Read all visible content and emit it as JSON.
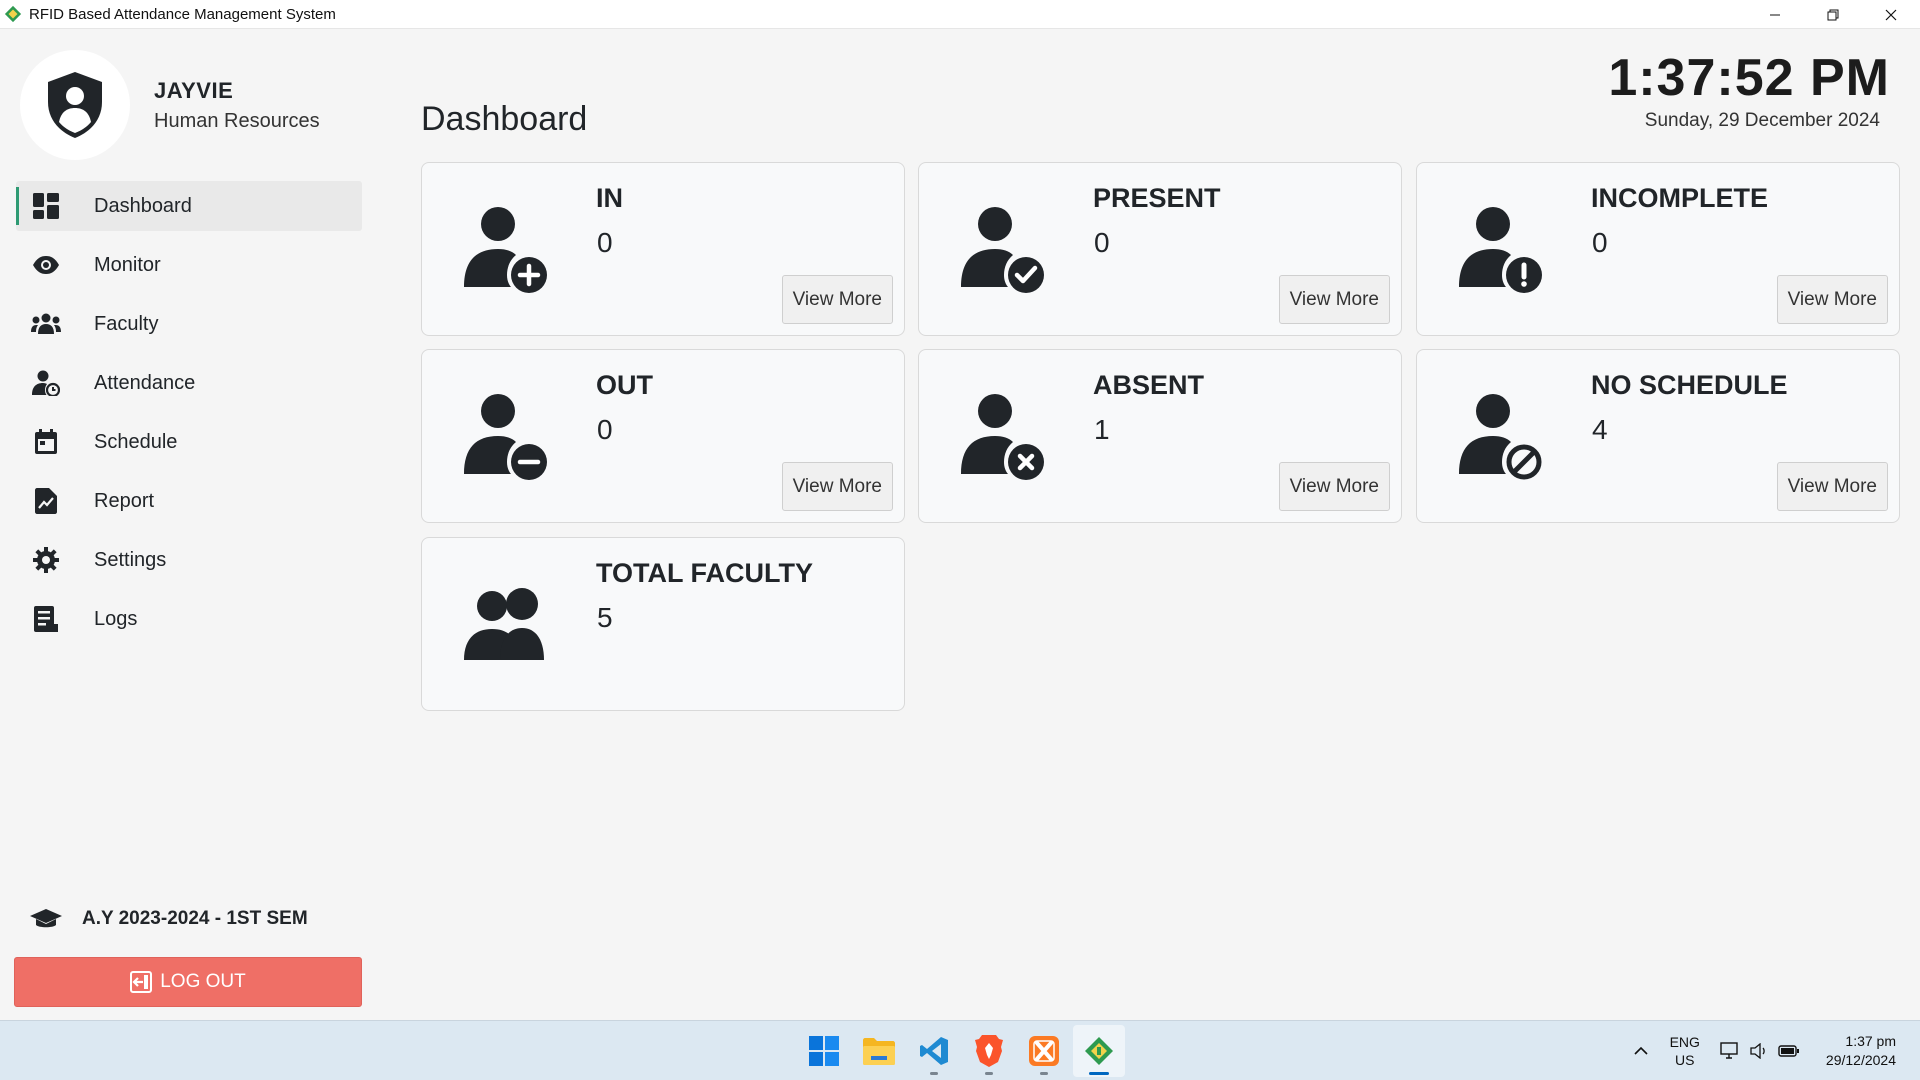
{
  "window": {
    "title": "RFID Based Attendance Management System",
    "minimize_icon": "minimize-icon",
    "maximize_icon": "restore-icon",
    "close_icon": "close-icon"
  },
  "profile": {
    "name": "JAYVIE",
    "role": "Human Resources",
    "avatar_icon": "user-shield-icon"
  },
  "sidebar": {
    "items": [
      {
        "label": "Dashboard",
        "icon": "dashboard-icon",
        "active": true
      },
      {
        "label": "Monitor",
        "icon": "eye-icon"
      },
      {
        "label": "Faculty",
        "icon": "users-icon"
      },
      {
        "label": "Attendance",
        "icon": "user-clock-icon"
      },
      {
        "label": "Schedule",
        "icon": "calendar-icon"
      },
      {
        "label": "Report",
        "icon": "report-chart-icon"
      },
      {
        "label": "Settings",
        "icon": "gear-icon"
      },
      {
        "label": "Logs",
        "icon": "logs-icon"
      }
    ],
    "academic_year": "A.Y 2023-2024 - 1ST SEM",
    "logout_label": "LOG OUT"
  },
  "header": {
    "page_title": "Dashboard",
    "time": "1:37:52 PM",
    "date": "Sunday, 29 December 2024"
  },
  "cards": [
    {
      "label": "IN",
      "value": "0",
      "button": "View More",
      "icon": "user-plus-icon"
    },
    {
      "label": "PRESENT",
      "value": "0",
      "button": "View More",
      "icon": "user-check-icon"
    },
    {
      "label": "INCOMPLETE",
      "value": "0",
      "button": "View More",
      "icon": "user-exclamation-icon"
    },
    {
      "label": "OUT",
      "value": "0",
      "button": "View More",
      "icon": "user-minus-icon"
    },
    {
      "label": "ABSENT",
      "value": "1",
      "button": "View More",
      "icon": "user-x-icon"
    },
    {
      "label": "NO SCHEDULE",
      "value": "4",
      "button": "View More",
      "icon": "user-slash-icon"
    },
    {
      "label": "TOTAL FACULTY",
      "value": "5",
      "icon": "users-icon"
    }
  ],
  "taskbar": {
    "apps": [
      "windows-start-icon",
      "file-explorer-icon",
      "vscode-icon",
      "brave-browser-icon",
      "xampp-icon",
      "rfid-app-icon"
    ],
    "language_line1": "ENG",
    "language_line2": "US",
    "clock_time": "1:37 pm",
    "clock_date": "29/12/2024"
  },
  "colors": {
    "accent": "#2e9a73",
    "logout": "#ef6f66",
    "icon_dark": "#212529"
  }
}
